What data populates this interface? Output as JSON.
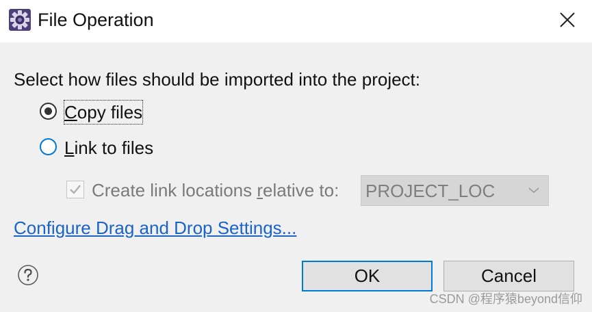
{
  "window": {
    "title": "File Operation",
    "icon": "eclipse-gear-icon",
    "close_icon": "close-icon"
  },
  "dialog": {
    "prompt": "Select how files should be imported into the project:",
    "options": [
      {
        "mnemonic": "C",
        "rest": "opy files",
        "selected": true
      },
      {
        "mnemonic": "L",
        "rest": "ink to files",
        "selected": false
      }
    ],
    "link_locations": {
      "label_before": "Create link locations ",
      "mnemonic": "r",
      "label_after": "elative to:",
      "checked": true,
      "enabled": false,
      "combo_value": "PROJECT_LOC"
    },
    "configure_link": "Configure Drag and Drop Settings...",
    "help_icon": "help-question-icon"
  },
  "buttons": {
    "ok": "OK",
    "cancel": "Cancel"
  },
  "watermark": "CSDN @程序猿beyond信仰",
  "colors": {
    "focus_blue": "#0078d7",
    "link_blue": "#1a63c7",
    "background": "#f0f0f0"
  }
}
